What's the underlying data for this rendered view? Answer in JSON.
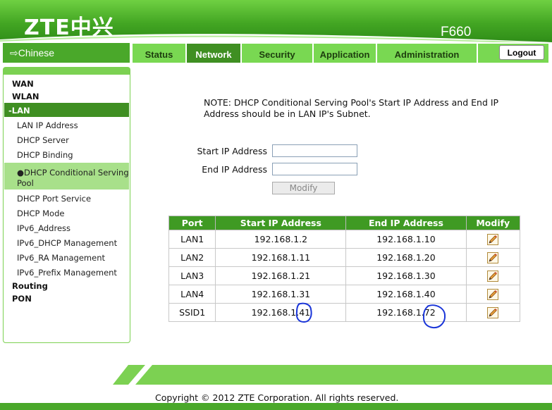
{
  "header": {
    "logo": "ZTE中兴",
    "model": "F660"
  },
  "lang_switch": "⇨Chinese",
  "tabs": [
    {
      "label": "Status",
      "active": false
    },
    {
      "label": "Network",
      "active": true
    },
    {
      "label": "Security",
      "active": false
    },
    {
      "label": "Application",
      "active": false
    },
    {
      "label": "Administration",
      "active": false
    }
  ],
  "logout_label": "Logout",
  "sidebar": {
    "wan": "WAN",
    "wlan": "WLAN",
    "lan": "-LAN",
    "items": [
      "LAN IP Address",
      "DHCP Server",
      "DHCP Binding",
      "●DHCP Conditional Serving Pool",
      "DHCP Port Service",
      "DHCP Mode",
      "IPv6_Address",
      "IPv6_DHCP Management",
      "IPv6_RA Management",
      "IPv6_Prefix Management"
    ],
    "routing": "Routing",
    "pon": "PON"
  },
  "note": "NOTE:  DHCP Conditional Serving Pool's Start IP Address and End IP Address should be in LAN IP's Subnet.",
  "form": {
    "start_label": "Start IP Address",
    "start_value": "",
    "end_label": "End IP Address",
    "end_value": "",
    "modify_label": "Modify"
  },
  "table": {
    "headers": [
      "Port",
      "Start IP Address",
      "End IP Address",
      "Modify"
    ],
    "rows": [
      [
        "LAN1",
        "192.168.1.2",
        "192.168.1.10"
      ],
      [
        "LAN2",
        "192.168.1.11",
        "192.168.1.20"
      ],
      [
        "LAN3",
        "192.168.1.21",
        "192.168.1.30"
      ],
      [
        "LAN4",
        "192.168.1.31",
        "192.168.1.40"
      ],
      [
        "SSID1",
        "192.168.1.41",
        "192.168.1.72"
      ]
    ]
  },
  "copyright": "Copyright © 2012 ZTE Corporation. All rights reserved.",
  "colors": {
    "brand_green": "#4aa82a",
    "tab_green": "#79d852",
    "active_tab": "#3f8f22",
    "annotation": "#1a35d8"
  }
}
